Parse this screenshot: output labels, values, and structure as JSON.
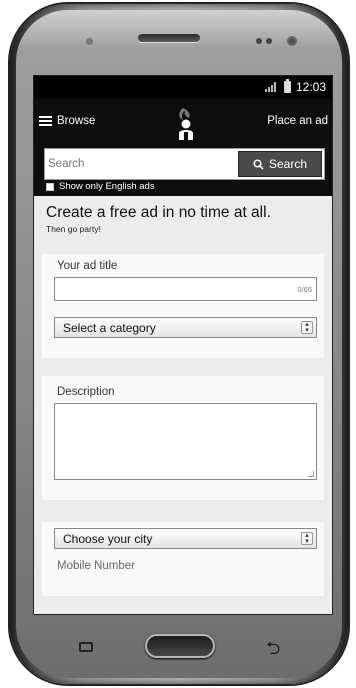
{
  "status": {
    "time": "12:03"
  },
  "nav": {
    "browse": "Browse",
    "place_ad": "Place an ad"
  },
  "search": {
    "placeholder": "Search",
    "button": "Search",
    "english_only": "Show only English ads"
  },
  "hero": {
    "title": "Create a free ad in no time at all.",
    "subtitle": "Then go party!"
  },
  "form": {
    "title_label": "Your ad title",
    "title_counter": "0/65",
    "category_select": "Select a category",
    "description_label": "Description",
    "city_select": "Choose your city",
    "mobile_label": "Mobile Number"
  },
  "colors": {
    "nav_bg": "#0d0d0d",
    "screen_bg": "#ececec",
    "button_bg": "#4a4a4a"
  }
}
